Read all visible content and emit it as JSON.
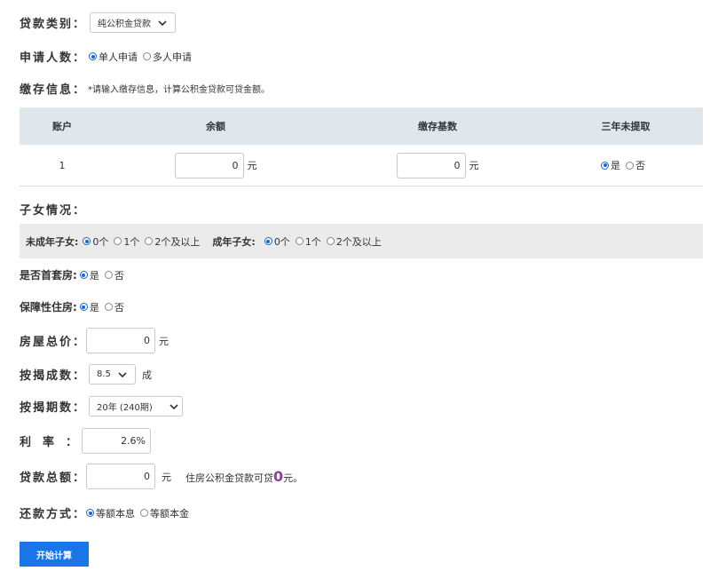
{
  "loan_type": {
    "label": "贷款类别：",
    "value": "纯公积金贷款"
  },
  "applicants": {
    "label": "申请人数：",
    "options": [
      "单人申请",
      "多人申请"
    ]
  },
  "deposit": {
    "label": "缴存信息：",
    "hint": "*请输入缴存信息，计算公积金贷款可贷金额。"
  },
  "table": {
    "headers": [
      "账户",
      "余额",
      "缴存基数",
      "三年未提取"
    ],
    "row": {
      "index": "1",
      "balance": "0",
      "base": "0",
      "unit": "元",
      "options": [
        "是",
        "否"
      ]
    }
  },
  "children": {
    "label": "子女情况：",
    "minor_label": "未成年子女:",
    "minor_options": [
      "0个",
      "1个",
      "2个及以上"
    ],
    "adult_label": "成年子女:",
    "adult_options": [
      "0个",
      "1个",
      "2个及以上"
    ]
  },
  "first_house": {
    "label": "是否首套房:",
    "options": [
      "是",
      "否"
    ]
  },
  "affordable": {
    "label": "保障性住房:",
    "options": [
      "是",
      "否"
    ]
  },
  "total_price": {
    "label": "房屋总价：",
    "value": "0",
    "unit": "元"
  },
  "mortgage_ratio": {
    "label": "按揭成数：",
    "value": "8.5",
    "unit": "成"
  },
  "mortgage_term": {
    "label": "按揭期数：",
    "value": "20年 (240期)"
  },
  "rate": {
    "label": "利　率　：",
    "value": "2.6%"
  },
  "loan_total": {
    "label": "贷款总额：",
    "value": "0",
    "unit": "元",
    "note_prefix": "住房公积金贷款可贷",
    "note_amount": "0",
    "note_suffix": "元。"
  },
  "repay": {
    "label": "还款方式：",
    "options": [
      "等额本息",
      "等额本金"
    ]
  },
  "submit": {
    "label": "开始计算"
  },
  "colors": {
    "accent": "#1a75e8",
    "header_bg": "#dfe7ed",
    "amount": "#8b3fa0"
  }
}
